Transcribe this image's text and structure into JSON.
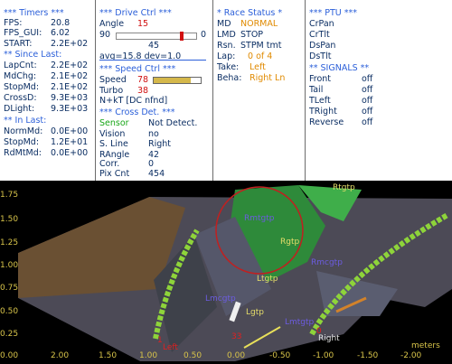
{
  "timers": {
    "title": "*** Timers ***",
    "fps_label": "FPS:",
    "fps_value": "20.8",
    "fps_gui_label": "FPS_GUI:",
    "fps_gui_value": "6.02",
    "start_label": "START:",
    "start_value": "2.2E+02",
    "since_last_title": "** Since Last:",
    "rows": [
      {
        "label": "LapCnt:",
        "value": "2.2E+02"
      },
      {
        "label": "MdChg:",
        "value": "2.1E+02"
      },
      {
        "label": "StopMd:",
        "value": "2.1E+02"
      },
      {
        "label": "CrossD:",
        "value": "9.3E+03"
      },
      {
        "label": "DLight:",
        "value": "9.3E+03"
      }
    ],
    "in_last_title": "** In Last:",
    "in_last_rows": [
      {
        "label": "NormMd:",
        "value": "0.0E+00"
      },
      {
        "label": "StopMd:",
        "value": "1.2E+01"
      },
      {
        "label": "RdMtMd:",
        "value": "0.0E+00"
      }
    ]
  },
  "drive": {
    "title": "***  Drive Ctrl  ***",
    "angle_label": "Angle",
    "angle_value": "15",
    "slider_min": "90",
    "slider_max": "0",
    "slider_mid": "45",
    "slider_level": 0.83,
    "avg_text": "avg=15.8  dev=1.0",
    "speed_title": "***  Speed Ctrl  ***",
    "speed_label": "Speed",
    "speed_value": "78",
    "turbo_label": "Turbo",
    "turbo_value": "38",
    "nkt_text": "N+kT [DC nfnd]",
    "cross_title": "***  Cross Det.  ***",
    "cross_rows": [
      {
        "label": "Sensor",
        "value": "Not Detect."
      },
      {
        "label": "Vision",
        "value": "no"
      },
      {
        "label": "S. Line",
        "value": "Right"
      },
      {
        "label": "RAngle",
        "value": "42"
      },
      {
        "label": "Corr.",
        "value": "0"
      },
      {
        "label": "Pix Cnt",
        "value": "454"
      }
    ]
  },
  "race": {
    "title": "* Race Status *",
    "rows": [
      {
        "label": "MD",
        "value": "NORMAL",
        "color": "#e08a00"
      },
      {
        "label": "LMD",
        "value": "STOP",
        "color": "#0b2e63"
      },
      {
        "label": "Rsn.",
        "value": "STPM tmt",
        "color": "#0b2e63"
      },
      {
        "label": "Lap:",
        "value": "0 of 4",
        "color": "#e08a00"
      },
      {
        "label": "Take:",
        "value": "Left",
        "color": "#e08a00"
      },
      {
        "label": "Beha:",
        "value": "Right Ln",
        "color": "#e08a00"
      }
    ]
  },
  "ptu": {
    "title": "*** PTU ***",
    "items": [
      "CrPan",
      "CrTlt",
      "DsPan",
      "DsTlt"
    ],
    "signals_title": "** SIGNALS **",
    "signals": [
      {
        "label": "Front",
        "value": "off"
      },
      {
        "label": "Tail",
        "value": "off"
      },
      {
        "label": "TLeft",
        "value": "off"
      },
      {
        "label": "TRight",
        "value": "off"
      },
      {
        "label": "Reverse",
        "value": "off"
      }
    ]
  },
  "viz": {
    "y_ticks": [
      "1.75",
      "1.50",
      "1.25",
      "1.00",
      "0.75",
      "0.50",
      "0.25",
      "0.00"
    ],
    "x_ticks": [
      "2.00",
      "1.50",
      "1.00",
      "0.50",
      "0.00",
      "-0.50",
      "-1.00",
      "-1.50",
      "-2.00"
    ],
    "x_unit": "meters",
    "markers": [
      "Rtgtp",
      "Rmtgtp",
      "Rgtp",
      "Rmcgtp",
      "Ltgtp",
      "Lmcgtp",
      "Lgtp",
      "Lmtgtp"
    ],
    "left_label": "Left",
    "right_label": "Right",
    "left_num": "1",
    "right_num": "0",
    "center_num": "33",
    "colors": {
      "header": "#2b5fd9",
      "value": "#0b2e63",
      "alert": "#d01010",
      "status": "#e08a00",
      "sensor": "#18a618",
      "axis": "#d8c44a"
    }
  }
}
